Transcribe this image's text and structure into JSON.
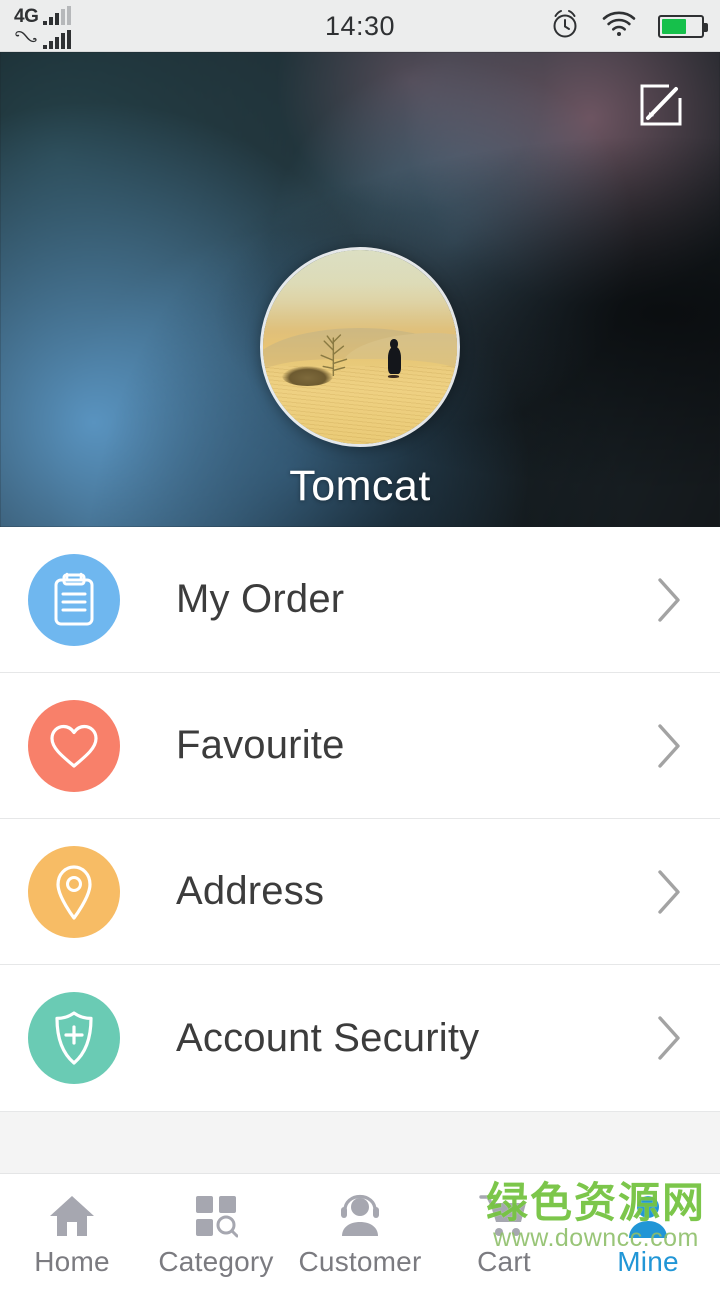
{
  "statusbar": {
    "network_label": "4G",
    "time": "14:30",
    "icons": [
      "signal-bars-icon",
      "phone-signal-icon",
      "alarm-clock-icon",
      "wifi-icon",
      "battery-icon"
    ],
    "battery_level_percent": 62
  },
  "header": {
    "edit_icon": "edit-compose-icon",
    "avatar_icon": "avatar-desert-photo",
    "username": "Tomcat"
  },
  "menu": {
    "items": [
      {
        "label": "My Order",
        "icon": "clipboard-icon",
        "color": "#6FB7EF",
        "arrow": "chevron-right-icon"
      },
      {
        "label": "Favourite",
        "icon": "heart-icon",
        "color": "#F8806A",
        "arrow": "chevron-right-icon"
      },
      {
        "label": "Address",
        "icon": "location-pin-icon",
        "color": "#F7BC65",
        "arrow": "chevron-right-icon"
      },
      {
        "label": "Account Security",
        "icon": "shield-plus-icon",
        "color": "#6ACBB4",
        "arrow": "chevron-right-icon"
      }
    ]
  },
  "tabbar": {
    "active_index": 4,
    "active_color": "#2196D6",
    "inactive_color": "#A6A7B0",
    "items": [
      {
        "label": "Home",
        "icon": "home-icon"
      },
      {
        "label": "Category",
        "icon": "grid-search-icon"
      },
      {
        "label": "Customer",
        "icon": "headset-person-icon"
      },
      {
        "label": "Cart",
        "icon": "shopping-cart-icon"
      },
      {
        "label": "Mine",
        "icon": "person-icon"
      }
    ]
  },
  "watermark": {
    "text_cn": "绿色资源网",
    "url": "www.downcc.com",
    "color": "#76C442"
  }
}
